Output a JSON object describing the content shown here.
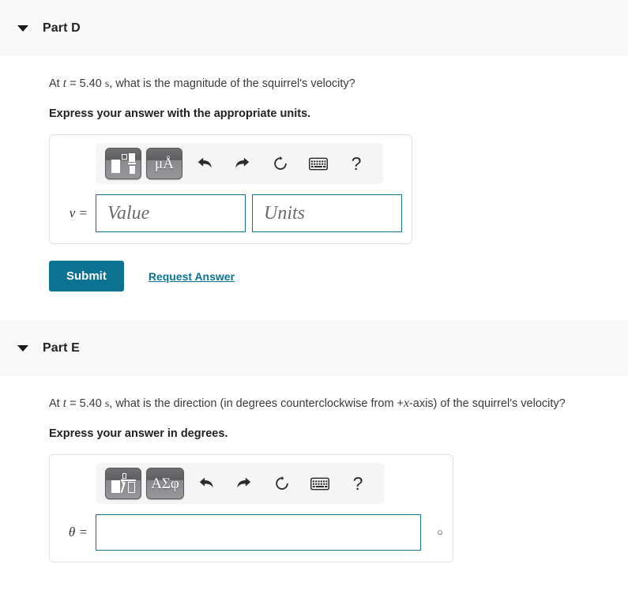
{
  "parts": [
    {
      "id": "part-d",
      "header": {
        "title": "Part D",
        "caret_icon": "caret-down-icon"
      },
      "question": {
        "prefix": "At ",
        "var": "t",
        "middle": " = 5.40 ",
        "unit": "s",
        "suffix": ", what is the magnitude of the squirrel's velocity?"
      },
      "instruction": "Express your answer with the appropriate units.",
      "toolbar": {
        "template_button": {
          "name": "math-template-button",
          "label": ""
        },
        "units_button": {
          "name": "units-symbols-button",
          "label": "μÅ"
        },
        "undo": "undo-icon",
        "redo": "redo-icon",
        "reset": "reset-icon",
        "keyboard": "keyboard-icon",
        "help": "?"
      },
      "input": {
        "variable_label": "v =",
        "value_placeholder": "Value",
        "units_placeholder": "Units",
        "value_current": "",
        "units_current": ""
      },
      "actions": {
        "submit_label": "Submit",
        "request_answer_label": "Request Answer"
      }
    },
    {
      "id": "part-e",
      "header": {
        "title": "Part E",
        "caret_icon": "caret-down-icon"
      },
      "question": {
        "prefix": "At ",
        "var": "t",
        "middle": " = 5.40 ",
        "unit": "s",
        "suffix": ", what is the direction (in degrees counterclockwise from +",
        "var2": "x",
        "suffix2": "-axis) of the squirrel's velocity?"
      },
      "instruction": "Express your answer in degrees.",
      "toolbar": {
        "template_button": {
          "name": "math-template-sqrt-button",
          "label": ""
        },
        "symbols_button": {
          "name": "greek-symbols-button",
          "label": "ΑΣφ"
        },
        "undo": "undo-icon",
        "redo": "redo-icon",
        "reset": "reset-icon",
        "keyboard": "keyboard-icon",
        "help": "?"
      },
      "input": {
        "variable_label": "θ =",
        "value_current": "",
        "value_placeholder": "",
        "degree_symbol": "○"
      }
    }
  ],
  "colors": {
    "accent": "#0b7391",
    "input_border": "#17708f",
    "header_band": "#f8f8f8",
    "toolbar_bg": "#f5f5f5",
    "panel_border": "#e0e0e0"
  }
}
